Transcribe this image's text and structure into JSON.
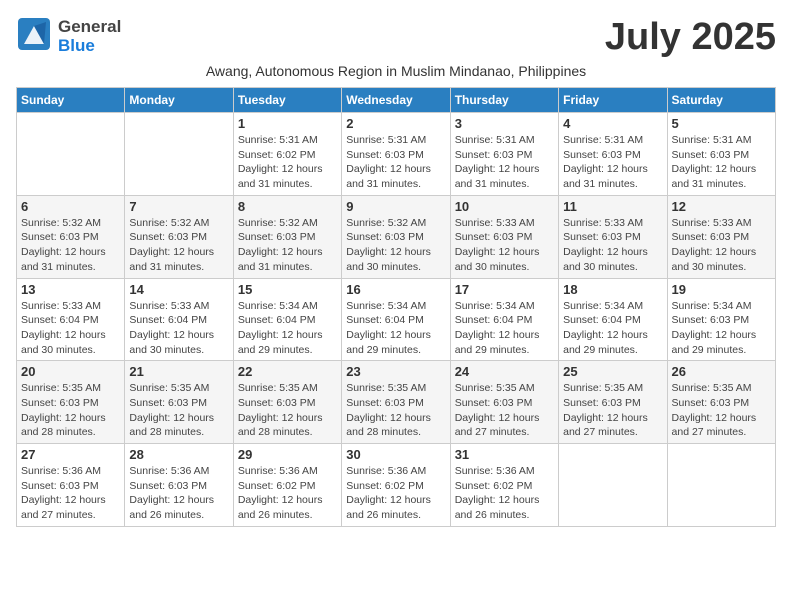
{
  "header": {
    "logo_line1": "General",
    "logo_line2": "Blue",
    "month_title": "July 2025",
    "subtitle": "Awang, Autonomous Region in Muslim Mindanao, Philippines"
  },
  "calendar": {
    "days_of_week": [
      "Sunday",
      "Monday",
      "Tuesday",
      "Wednesday",
      "Thursday",
      "Friday",
      "Saturday"
    ],
    "weeks": [
      [
        {
          "day": "",
          "info": ""
        },
        {
          "day": "",
          "info": ""
        },
        {
          "day": "1",
          "info": "Sunrise: 5:31 AM\nSunset: 6:02 PM\nDaylight: 12 hours and 31 minutes."
        },
        {
          "day": "2",
          "info": "Sunrise: 5:31 AM\nSunset: 6:03 PM\nDaylight: 12 hours and 31 minutes."
        },
        {
          "day": "3",
          "info": "Sunrise: 5:31 AM\nSunset: 6:03 PM\nDaylight: 12 hours and 31 minutes."
        },
        {
          "day": "4",
          "info": "Sunrise: 5:31 AM\nSunset: 6:03 PM\nDaylight: 12 hours and 31 minutes."
        },
        {
          "day": "5",
          "info": "Sunrise: 5:31 AM\nSunset: 6:03 PM\nDaylight: 12 hours and 31 minutes."
        }
      ],
      [
        {
          "day": "6",
          "info": "Sunrise: 5:32 AM\nSunset: 6:03 PM\nDaylight: 12 hours and 31 minutes."
        },
        {
          "day": "7",
          "info": "Sunrise: 5:32 AM\nSunset: 6:03 PM\nDaylight: 12 hours and 31 minutes."
        },
        {
          "day": "8",
          "info": "Sunrise: 5:32 AM\nSunset: 6:03 PM\nDaylight: 12 hours and 31 minutes."
        },
        {
          "day": "9",
          "info": "Sunrise: 5:32 AM\nSunset: 6:03 PM\nDaylight: 12 hours and 30 minutes."
        },
        {
          "day": "10",
          "info": "Sunrise: 5:33 AM\nSunset: 6:03 PM\nDaylight: 12 hours and 30 minutes."
        },
        {
          "day": "11",
          "info": "Sunrise: 5:33 AM\nSunset: 6:03 PM\nDaylight: 12 hours and 30 minutes."
        },
        {
          "day": "12",
          "info": "Sunrise: 5:33 AM\nSunset: 6:03 PM\nDaylight: 12 hours and 30 minutes."
        }
      ],
      [
        {
          "day": "13",
          "info": "Sunrise: 5:33 AM\nSunset: 6:04 PM\nDaylight: 12 hours and 30 minutes."
        },
        {
          "day": "14",
          "info": "Sunrise: 5:33 AM\nSunset: 6:04 PM\nDaylight: 12 hours and 30 minutes."
        },
        {
          "day": "15",
          "info": "Sunrise: 5:34 AM\nSunset: 6:04 PM\nDaylight: 12 hours and 29 minutes."
        },
        {
          "day": "16",
          "info": "Sunrise: 5:34 AM\nSunset: 6:04 PM\nDaylight: 12 hours and 29 minutes."
        },
        {
          "day": "17",
          "info": "Sunrise: 5:34 AM\nSunset: 6:04 PM\nDaylight: 12 hours and 29 minutes."
        },
        {
          "day": "18",
          "info": "Sunrise: 5:34 AM\nSunset: 6:04 PM\nDaylight: 12 hours and 29 minutes."
        },
        {
          "day": "19",
          "info": "Sunrise: 5:34 AM\nSunset: 6:03 PM\nDaylight: 12 hours and 29 minutes."
        }
      ],
      [
        {
          "day": "20",
          "info": "Sunrise: 5:35 AM\nSunset: 6:03 PM\nDaylight: 12 hours and 28 minutes."
        },
        {
          "day": "21",
          "info": "Sunrise: 5:35 AM\nSunset: 6:03 PM\nDaylight: 12 hours and 28 minutes."
        },
        {
          "day": "22",
          "info": "Sunrise: 5:35 AM\nSunset: 6:03 PM\nDaylight: 12 hours and 28 minutes."
        },
        {
          "day": "23",
          "info": "Sunrise: 5:35 AM\nSunset: 6:03 PM\nDaylight: 12 hours and 28 minutes."
        },
        {
          "day": "24",
          "info": "Sunrise: 5:35 AM\nSunset: 6:03 PM\nDaylight: 12 hours and 27 minutes."
        },
        {
          "day": "25",
          "info": "Sunrise: 5:35 AM\nSunset: 6:03 PM\nDaylight: 12 hours and 27 minutes."
        },
        {
          "day": "26",
          "info": "Sunrise: 5:35 AM\nSunset: 6:03 PM\nDaylight: 12 hours and 27 minutes."
        }
      ],
      [
        {
          "day": "27",
          "info": "Sunrise: 5:36 AM\nSunset: 6:03 PM\nDaylight: 12 hours and 27 minutes."
        },
        {
          "day": "28",
          "info": "Sunrise: 5:36 AM\nSunset: 6:03 PM\nDaylight: 12 hours and 26 minutes."
        },
        {
          "day": "29",
          "info": "Sunrise: 5:36 AM\nSunset: 6:02 PM\nDaylight: 12 hours and 26 minutes."
        },
        {
          "day": "30",
          "info": "Sunrise: 5:36 AM\nSunset: 6:02 PM\nDaylight: 12 hours and 26 minutes."
        },
        {
          "day": "31",
          "info": "Sunrise: 5:36 AM\nSunset: 6:02 PM\nDaylight: 12 hours and 26 minutes."
        },
        {
          "day": "",
          "info": ""
        },
        {
          "day": "",
          "info": ""
        }
      ]
    ]
  }
}
